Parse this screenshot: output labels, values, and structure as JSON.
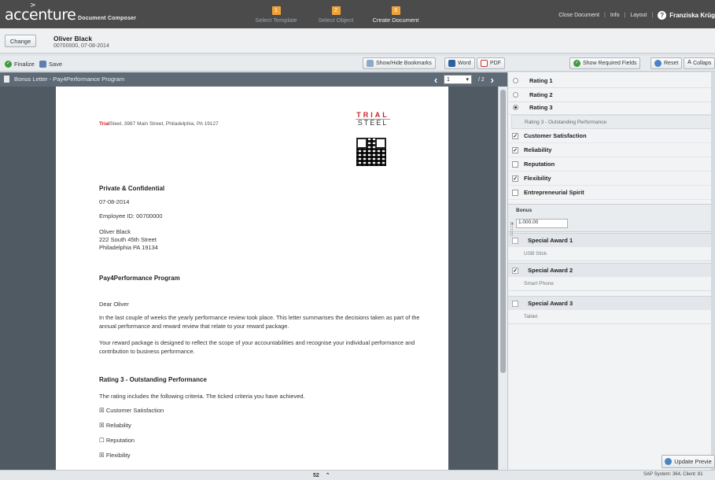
{
  "header": {
    "brand": "accenture",
    "subtitle": "Document Composer",
    "steps": [
      {
        "num": "1",
        "label": "Select Template"
      },
      {
        "num": "2",
        "label": "Select Object"
      },
      {
        "num": "3",
        "label": "Create Document"
      }
    ],
    "close_document": "Close Document",
    "info": "Info",
    "layout": "Layout",
    "user_icon": "?",
    "user_name": "Franziska Krüg"
  },
  "recipient": {
    "change_label": "Change",
    "name": "Oliver Black",
    "meta": "00700000, 07-08-2014"
  },
  "toolbar": {
    "finalize": "Finalize",
    "save": "Save",
    "bookmarks": "Show/Hide Bookmarks",
    "word": "Word",
    "pdf": "PDF",
    "required": "Show Required Fields",
    "reset": "Reset",
    "collapse": "Collaps"
  },
  "document": {
    "title": "Bonus Letter - Pay4Performance Program",
    "page_current": "1",
    "page_total": "/ 2",
    "address_brand": "Trial",
    "address_rest": "Steel, 3987 Main Street, Philadelphia, PA 19127",
    "logo_top": "TRIAL",
    "logo_bottom": "STEEL",
    "confidential": "Private & Confidential",
    "date": "07-08-2014",
    "employee_id": "Employee ID: 00700000",
    "addr_name": "Oliver Black",
    "addr_street": "222 South 45th Street",
    "addr_city": "Philadelphia PA 19134",
    "program": "Pay4Performance Program",
    "greeting": "Dear Oliver",
    "para1": "In the last couple of weeks the yearly performance review took place. This letter summarises the decisions taken as part of the annual performance and reward review that relate to your reward package.",
    "para2": "Your reward package is designed to reflect the scope of your accountabilities and recognise your individual performance and contribution to business performance.",
    "rating_heading": "Rating 3 - Outstanding Performance",
    "rating_text": "The rating includes the following criteria. The ticked criteria you have achieved.",
    "criteria": [
      {
        "label": "Customer Satisfaction",
        "mark": "☒"
      },
      {
        "label": "Reliability",
        "mark": "☒"
      },
      {
        "label": "Reputation",
        "mark": "☐"
      },
      {
        "label": "Flexibility",
        "mark": "☒"
      }
    ]
  },
  "panel": {
    "ratings": [
      {
        "label": "Rating 1",
        "selected": false
      },
      {
        "label": "Rating 2",
        "selected": false
      },
      {
        "label": "Rating 3",
        "selected": true
      }
    ],
    "rating_desc": "Rating 3 - Outstanding Performance",
    "criteria": [
      {
        "label": "Customer Satisfaction",
        "checked": true
      },
      {
        "label": "Reliability",
        "checked": true
      },
      {
        "label": "Reputation",
        "checked": false
      },
      {
        "label": "Flexibility",
        "checked": true
      },
      {
        "label": "Entrepreneurial Spirit",
        "checked": false
      }
    ],
    "bonus_label": "Bonus",
    "bonus_value": "1.000.00",
    "awards": [
      {
        "label": "Special Award 1",
        "item": "USB Stick",
        "checked": false
      },
      {
        "label": "Special Award 2",
        "item": "Smart Phone",
        "checked": true
      },
      {
        "label": "Special Award 3",
        "item": "Tablet",
        "checked": false
      }
    ],
    "update": "Update Previe"
  },
  "status": {
    "zoom": "52",
    "system": "SAP System: 364, Client: 81"
  },
  "colors": {
    "header_bg": "#4b4b4b",
    "step_accent": "#f0a13a",
    "brand_red": "#c8232c",
    "doc_bg": "#505a63"
  }
}
